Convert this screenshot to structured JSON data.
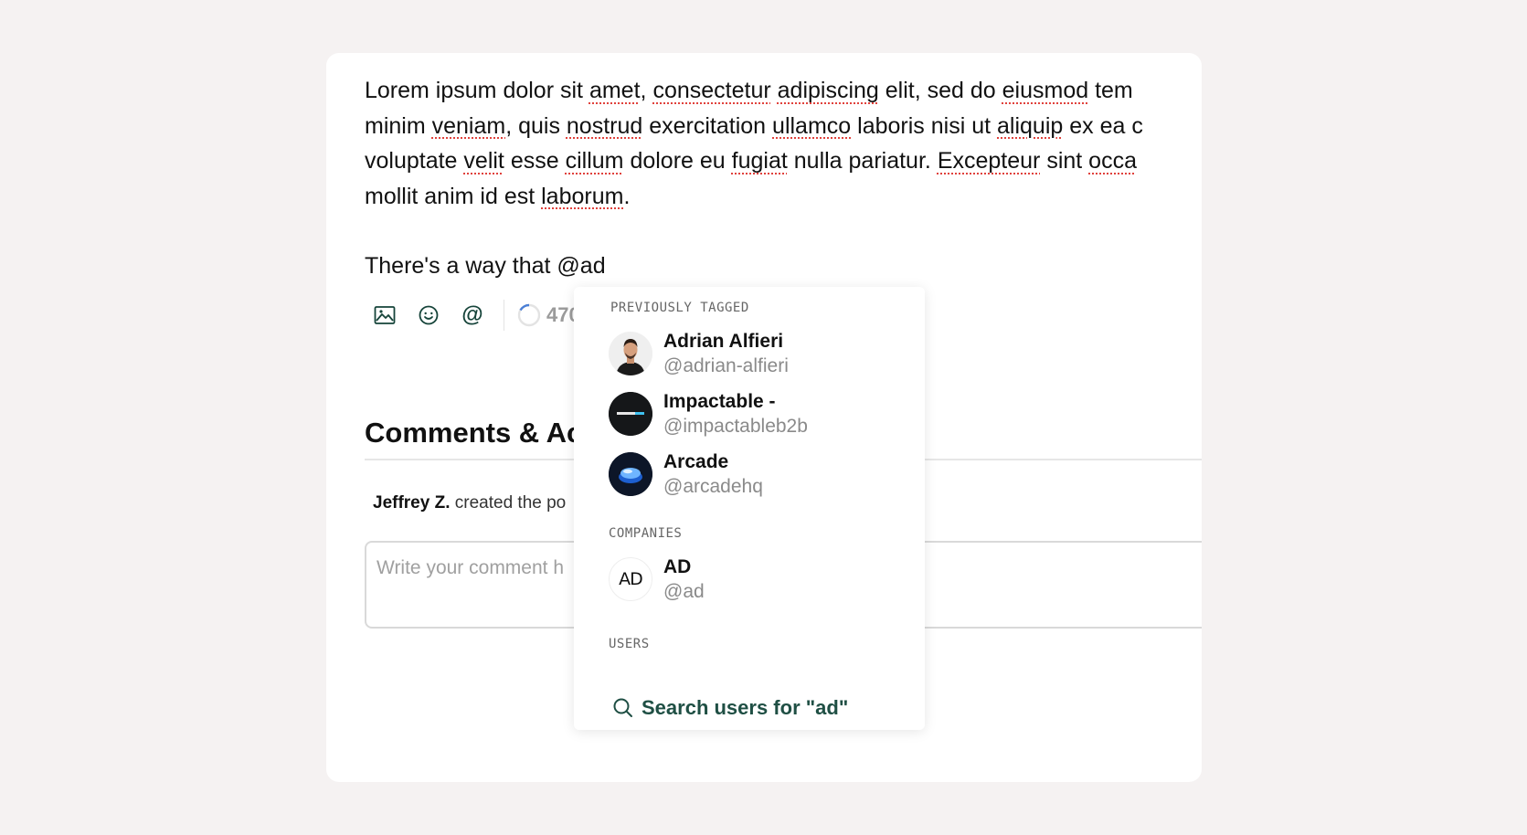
{
  "editor": {
    "paragraph_lines": [
      [
        {
          "t": "Lorem ipsum dolor sit "
        },
        {
          "t": "amet",
          "sp": true
        },
        {
          "t": ", "
        },
        {
          "t": "consectetur",
          "sp": true
        },
        {
          "t": " "
        },
        {
          "t": "adipiscing",
          "sp": true
        },
        {
          "t": " elit, sed do "
        },
        {
          "t": "eiusmod",
          "sp": true
        },
        {
          "t": " tem"
        }
      ],
      [
        {
          "t": "minim "
        },
        {
          "t": "veniam",
          "sp": true
        },
        {
          "t": ", quis "
        },
        {
          "t": "nostrud",
          "sp": true
        },
        {
          "t": " exercitation "
        },
        {
          "t": "ullamco",
          "sp": true
        },
        {
          "t": " laboris nisi ut "
        },
        {
          "t": "aliquip",
          "sp": true
        },
        {
          "t": " ex ea c"
        }
      ],
      [
        {
          "t": "voluptate "
        },
        {
          "t": "velit",
          "sp": true
        },
        {
          "t": " esse "
        },
        {
          "t": "cillum",
          "sp": true
        },
        {
          "t": " dolore eu "
        },
        {
          "t": "fugiat",
          "sp": true
        },
        {
          "t": " nulla pariatur. "
        },
        {
          "t": "Excepteur",
          "sp": true
        },
        {
          "t": " sint "
        },
        {
          "t": "occa",
          "sp": true
        }
      ],
      [
        {
          "t": "mollit anim id est "
        },
        {
          "t": "laborum",
          "sp": true
        },
        {
          "t": "."
        }
      ]
    ],
    "second_line": "There's a way that @ad"
  },
  "toolbar": {
    "image_icon": "image-icon",
    "emoji_icon": "smiley-icon",
    "mention_label": "@",
    "counter_value": "470"
  },
  "comments": {
    "title": "Comments & Ac",
    "activity_user": "Jeffrey Z.",
    "activity_text": "created the po",
    "input_placeholder": "Write your comment h"
  },
  "mention_dropdown": {
    "previously_tagged_heading": "PREVIOUSLY TAGGED",
    "previously_tagged": [
      {
        "name": "Adrian Alfieri",
        "handle": "@adrian-alfieri",
        "avatar": "person-avatar"
      },
      {
        "name": "Impactable -",
        "handle": "@impactableb2b",
        "avatar": "impactable-logo"
      },
      {
        "name": "Arcade",
        "handle": "@arcadehq",
        "avatar": "arcade-logo"
      }
    ],
    "companies_heading": "COMPANIES",
    "companies": [
      {
        "name": "AD",
        "handle": "@ad",
        "avatar": "ad-logo",
        "logo_text": "AD"
      }
    ],
    "users_heading": "USERS",
    "search_users_label": "Search users for \"ad\""
  },
  "colors": {
    "page_bg": "#f5f2f2",
    "accent_green": "#1f4f44",
    "spellcheck_red": "#e0413c"
  }
}
